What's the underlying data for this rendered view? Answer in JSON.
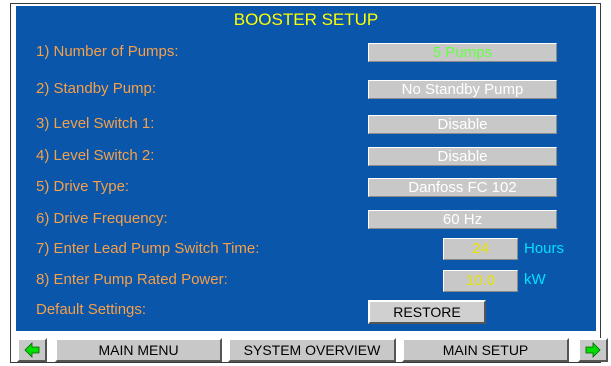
{
  "title": "BOOSTER SETUP",
  "settings": [
    {
      "label": "1) Number of Pumps:",
      "value": "5 Pumps"
    },
    {
      "label": "2) Standby Pump:",
      "value": "No Standby Pump"
    },
    {
      "label": "3) Level Switch 1:",
      "value": "Disable"
    },
    {
      "label": "4) Level Switch 2:",
      "value": "Disable"
    },
    {
      "label": "5) Drive Type:",
      "value": "Danfoss FC 102"
    },
    {
      "label": "6) Drive Frequency:",
      "value": "60 Hz"
    }
  ],
  "numeric_settings": [
    {
      "label": "7) Enter Lead Pump Switch Time:",
      "value": "24",
      "unit": "Hours"
    },
    {
      "label": "8) Enter Pump Rated Power:",
      "value": "10.0",
      "unit": "kW"
    }
  ],
  "defaults": {
    "label": "Default Settings:",
    "restore_label": "RESTORE"
  },
  "nav": {
    "main_menu": "MAIN MENU",
    "system_overview": "SYSTEM OVERVIEW",
    "main_setup": "MAIN SETUP"
  },
  "colors": {
    "panel_bg": "#0a56aa",
    "title": "#ffff00",
    "label": "#f5a04a",
    "unit": "#00e0ff",
    "first_value": "#66ff44",
    "numeric_value": "#e6e600",
    "arrow": "#00dd00"
  },
  "icons": {
    "prev": "left-arrow-icon",
    "next": "right-arrow-icon"
  }
}
